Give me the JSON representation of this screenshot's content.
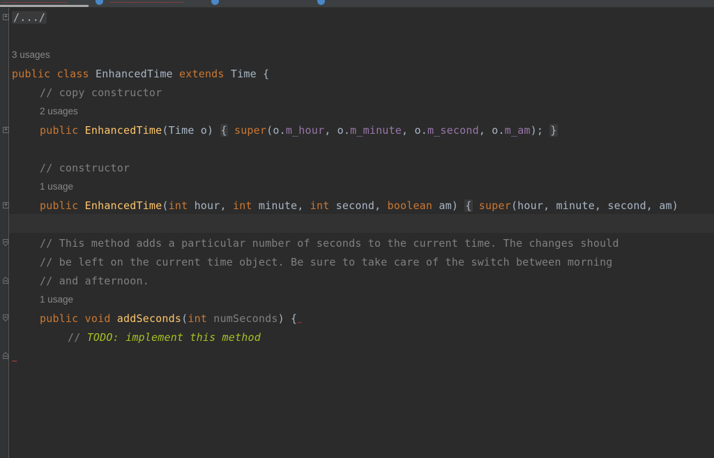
{
  "editor": {
    "collapsed_imports": "/.../",
    "class_usages": "3 usages",
    "class_decl": {
      "public": "public",
      "class": "class",
      "name": "EnhancedTime",
      "extends": "extends",
      "parent": "Time",
      "brace": " {"
    },
    "copy_comment": "// copy constructor",
    "copy_usages": "2 usages",
    "copy_ctor": {
      "public": "public",
      "name": "EnhancedTime",
      "params": "(Time o)",
      "open": "{",
      "super": "super",
      "arg_open": "(o.",
      "f1": "m_hour",
      "sep1": ", o.",
      "f2": "m_minute",
      "sep2": ", o.",
      "f3": "m_second",
      "sep3": ", o.",
      "f4": "m_am",
      "end": ");",
      "close": "}"
    },
    "ctor_comment": "// constructor",
    "ctor_usages": "1 usage",
    "ctor": {
      "public": "public",
      "name": "EnhancedTime",
      "open_paren": "(",
      "int1": "int",
      "p1": " hour, ",
      "int2": "int",
      "p2": " minute, ",
      "int3": "int",
      "p3": " second, ",
      "bool": "boolean",
      "p4": " am)",
      "open": "{",
      "super": "super",
      "args": "(hour, minute, second, am)"
    },
    "method_comment_1": "// This method adds a particular number of seconds to the current time. The changes should",
    "method_comment_2": "// be left on the current time object. Be sure to take care of the switch between morning",
    "method_comment_3": "// and afternoon.",
    "method_usages": "1 usage",
    "method": {
      "public": "public",
      "void": "void",
      "name": "addSeconds",
      "int": "int",
      "param": "numSeconds",
      "close": ") {"
    },
    "todo_slashes": "// ",
    "todo_text": "TODO: implement this method",
    "end_marker": "~"
  },
  "colors": {
    "background": "#2b2b2b",
    "keyword": "#cc7832",
    "comment": "#808080",
    "function": "#ffc66d",
    "field": "#9876aa",
    "todo": "#a8c023",
    "text": "#a9b7c6"
  }
}
